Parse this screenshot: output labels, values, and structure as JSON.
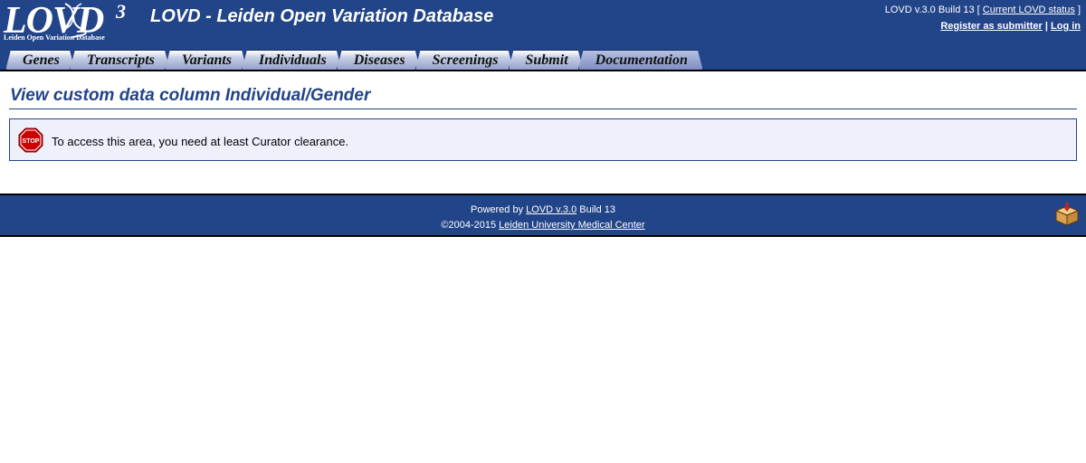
{
  "logo": {
    "main": "LOVD",
    "sup": "3",
    "subtitle": "Leiden Open Variation Database"
  },
  "header": {
    "title": "LOVD - Leiden Open Variation Database",
    "version_prefix": "LOVD v.3.0 Build 13 [",
    "status_link": "Current LOVD status",
    "version_suffix": "]",
    "register_link": "Register as submitter",
    "separator": "|",
    "login_link": "Log in"
  },
  "tabs": [
    {
      "label": "Genes"
    },
    {
      "label": "Transcripts"
    },
    {
      "label": "Variants"
    },
    {
      "label": "Individuals"
    },
    {
      "label": "Diseases"
    },
    {
      "label": "Screenings"
    },
    {
      "label": "Submit"
    },
    {
      "label": "Documentation"
    }
  ],
  "main": {
    "title": "View custom data column Individual/Gender",
    "message": "To access this area, you need at least Curator clearance.",
    "stop_icon_text": "STOP"
  },
  "footer": {
    "powered_prefix": "Powered by",
    "powered_link": "LOVD v.3.0",
    "powered_suffix": "Build 13",
    "copyright_prefix": "©2004-2015",
    "copyright_link": "Leiden University Medical Center"
  },
  "icons": {
    "stop": "stop-sign-icon",
    "box": "package-icon"
  },
  "colors": {
    "brand": "#224488",
    "message_bg": "#eef1fc",
    "stop_red": "#cc0000"
  }
}
